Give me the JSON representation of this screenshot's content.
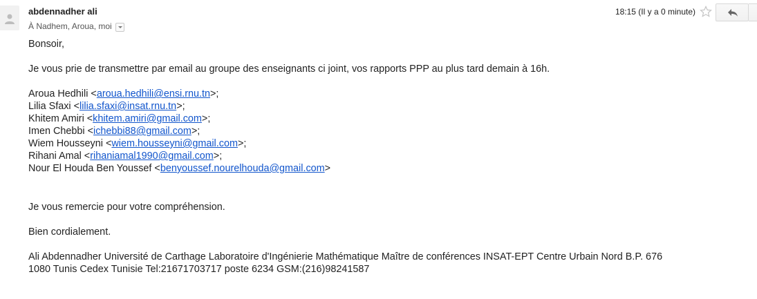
{
  "header": {
    "sender": "abdennadher ali",
    "recipients": "À Nadhem, Aroua, moi",
    "timestamp": "18:15 (Il y a 0 minute)",
    "star_icon": "star-outline-icon",
    "reply_icon": "reply-arrow-icon",
    "more_icon": "chevron-down-icon"
  },
  "body": {
    "greeting": "Bonsoir,",
    "request": "Je vous prie de transmettre par email au groupe des enseignants ci joint, vos rapports PPP au plus tard demain à 16h.",
    "contacts": [
      {
        "name": "Aroua Hedhili",
        "email": "aroua.hedhili@ensi.rnu.tn",
        "suffix": ">;"
      },
      {
        "name": "Lilia Sfaxi",
        "email": "lilia.sfaxi@insat.rnu.tn",
        "suffix": ">;"
      },
      {
        "name": "Khitem Amiri",
        "email": "khitem.amiri@gmail.com",
        "suffix": ">;"
      },
      {
        "name": "Imen Chebbi",
        "email": "ichebbi88@gmail.com",
        "suffix": ">;"
      },
      {
        "name": "Wiem Housseyni",
        "email": "wiem.housseyni@gmail.com",
        "suffix": ">;"
      },
      {
        "name": "Rihani Amal",
        "email": "rihaniamal1990@gmail.com",
        "suffix": ">;"
      },
      {
        "name": "Nour El Houda Ben Youssef",
        "email": "benyoussef.nourelhouda@gmail.com",
        "suffix": ">"
      }
    ],
    "thanks": "Je vous remercie pour votre compréhension.",
    "closing": "Bien cordialement.",
    "signature_line1": "Ali Abdennadher Université de Carthage Laboratoire d'Ingénierie Mathématique Maître de conférences INSAT-EPT Centre Urbain Nord B.P. 676",
    "signature_line2": "1080 Tunis Cedex Tunisie Tel:21671703717 poste 6234 GSM:(216)98241587"
  },
  "colors": {
    "link": "#1155cc",
    "text": "#222222",
    "muted": "#555555"
  }
}
